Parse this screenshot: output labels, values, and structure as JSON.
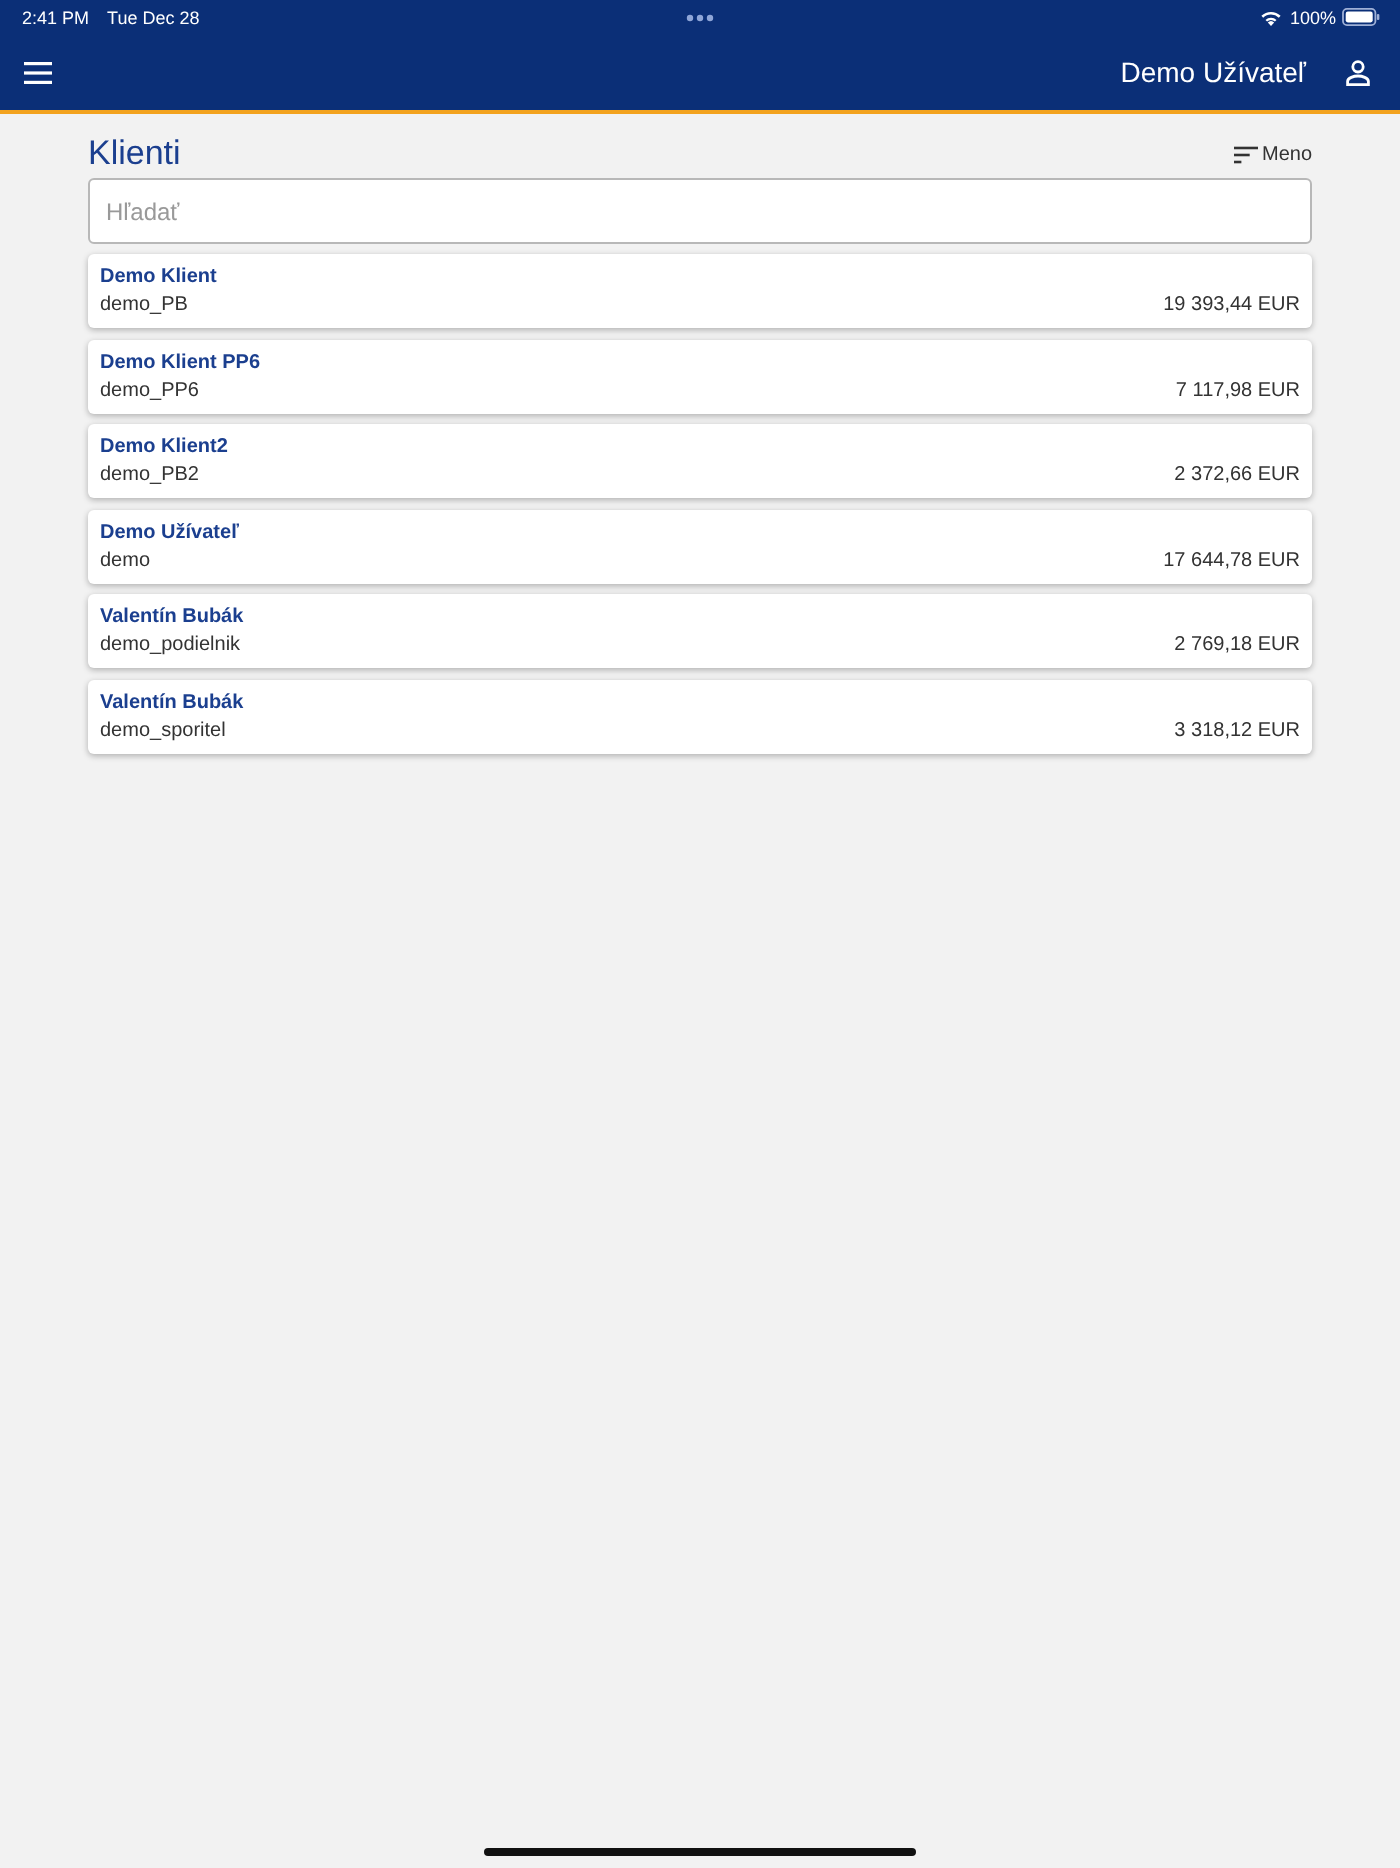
{
  "status_bar": {
    "time": "2:41 PM",
    "date": "Tue Dec 28",
    "battery": "100%"
  },
  "header": {
    "user_name": "Demo Užívateľ"
  },
  "page": {
    "title": "Klienti",
    "sort": {
      "label": "Meno"
    },
    "search": {
      "placeholder": "Hľadať"
    }
  },
  "clients": [
    {
      "name": "Demo Klient",
      "login": "demo_PB",
      "balance": "19 393,44 EUR"
    },
    {
      "name": "Demo Klient PP6",
      "login": "demo_PP6",
      "balance": "7 117,98 EUR"
    },
    {
      "name": "Demo Klient2",
      "login": "demo_PB2",
      "balance": "2 372,66 EUR"
    },
    {
      "name": "Demo Užívateľ",
      "login": "demo",
      "balance": "17 644,78 EUR"
    },
    {
      "name": "Valentín Bubák",
      "login": "demo_podielnik",
      "balance": "2 769,18 EUR"
    },
    {
      "name": "Valentín Bubák",
      "login": "demo_sporitel",
      "balance": "3 318,12 EUR"
    }
  ]
}
